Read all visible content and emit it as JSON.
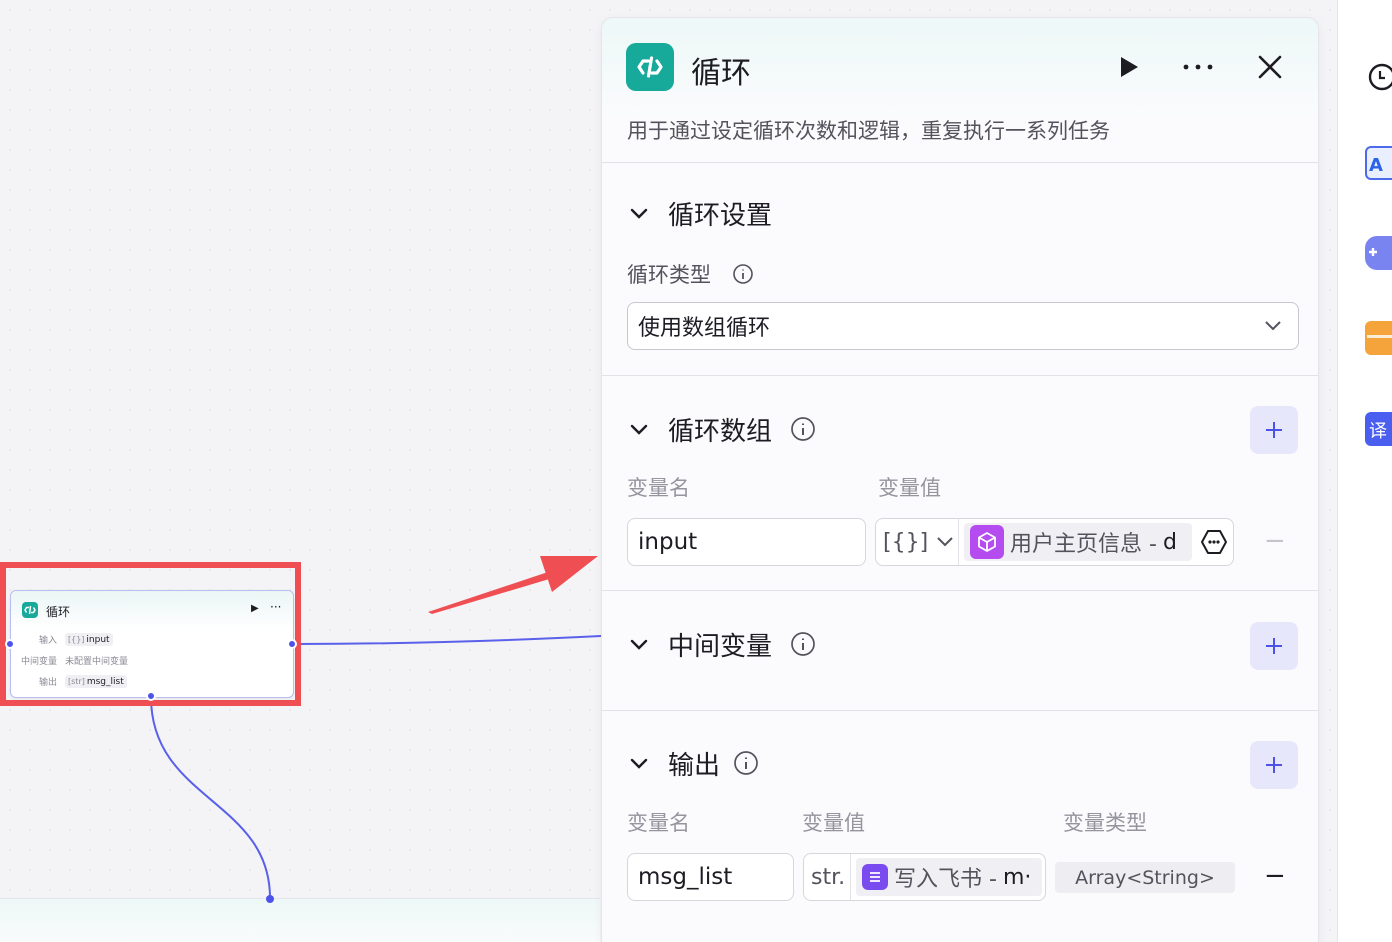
{
  "canvas": {
    "node": {
      "title": "循环",
      "rows": [
        {
          "label": "输入",
          "type_glyph": "[{}]",
          "value": "input"
        },
        {
          "label": "中间变量",
          "value": "未配置中间变量"
        },
        {
          "label": "输出",
          "type_glyph": "[str]",
          "value": "msg_list"
        }
      ]
    }
  },
  "panel": {
    "title": "循环",
    "description": "用于通过设定循环次数和逻辑，重复执行一系列任务",
    "loop_settings": {
      "title": "循环设置",
      "type_label": "循环类型",
      "type_value": "使用数组循环"
    },
    "loop_array": {
      "title": "循环数组",
      "col_name": "变量名",
      "col_value": "变量值",
      "row": {
        "name": "input",
        "type_glyph": "[{}]",
        "ref_text": "用户主页信息 -",
        "ref_tail": "d"
      }
    },
    "middle_vars": {
      "title": "中间变量"
    },
    "output": {
      "title": "输出",
      "col_name": "变量名",
      "col_value": "变量值",
      "col_type": "变量类型",
      "row": {
        "name": "msg_list",
        "type_glyph": "str.",
        "ref_text": "写入飞书 -",
        "ref_tail": "m·",
        "var_type": "Array<String>"
      }
    }
  },
  "side_icons": [
    "clock-icon",
    "ai-app-icon",
    "gamepad-icon",
    "toolbox-icon",
    "translate-icon"
  ],
  "colors": {
    "accent": "#4d53e8",
    "loop_icon": "#17a99a",
    "highlight": "#ef4e53",
    "chip_purple": "#b44cf0",
    "chip_violet": "#7a4cf0"
  }
}
